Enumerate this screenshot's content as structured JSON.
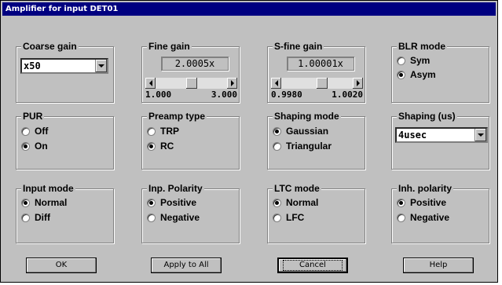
{
  "window": {
    "title": "Amplifier for input DET01"
  },
  "coarse_gain": {
    "label": "Coarse gain",
    "value": "x50"
  },
  "fine_gain": {
    "label": "Fine gain",
    "value": "2.0005x",
    "min": "1.000",
    "max": "3.000",
    "position_fraction": 0.5
  },
  "sfine_gain": {
    "label": "S-fine gain",
    "value": "1.00001x",
    "min": "0.9980",
    "max": "1.0020",
    "position_fraction": 0.5
  },
  "blr_mode": {
    "label": "BLR mode",
    "options": [
      "Sym",
      "Asym"
    ],
    "selected": 1
  },
  "pur": {
    "label": "PUR",
    "options": [
      "Off",
      "On"
    ],
    "selected": 1
  },
  "preamp_type": {
    "label": "Preamp type",
    "options": [
      "TRP",
      "RC"
    ],
    "selected": 1
  },
  "shaping_mode": {
    "label": "Shaping mode",
    "options": [
      "Gaussian",
      "Triangular"
    ],
    "selected": 0
  },
  "shaping_us": {
    "label": "Shaping (us)",
    "value": "4usec"
  },
  "input_mode": {
    "label": "Input mode",
    "options": [
      "Normal",
      "Diff"
    ],
    "selected": 0
  },
  "inp_polarity": {
    "label": "Inp. Polarity",
    "options": [
      "Positive",
      "Negative"
    ],
    "selected": 0
  },
  "ltc_mode": {
    "label": "LTC mode",
    "options": [
      "Normal",
      "LFC"
    ],
    "selected": 0
  },
  "inh_polarity": {
    "label": "Inh. polarity",
    "options": [
      "Positive",
      "Negative"
    ],
    "selected": 0
  },
  "buttons": {
    "ok": "OK",
    "apply_all": "Apply to All",
    "cancel": "Cancel",
    "help": "Help"
  },
  "colors": {
    "title_bar": "#000080",
    "face": "#c0c0c0"
  },
  "icons": [
    "chevron-down-icon",
    "scroll-left-icon",
    "scroll-right-icon"
  ]
}
